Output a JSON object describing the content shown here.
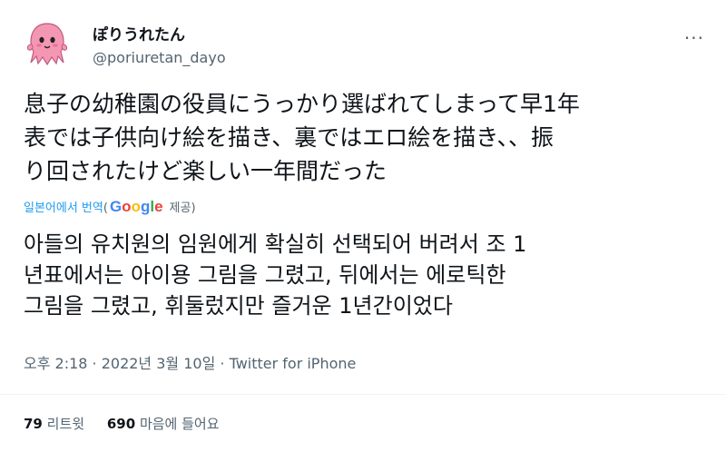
{
  "user": {
    "display_name": "ぽりうれたん",
    "handle": "@poriuretan_dayo"
  },
  "tweet": {
    "lines": [
      "息子の幼稚園の役員にうっかり選ばれてしまって早1年",
      "表では子供向け絵を描き、裏ではエロ絵を描き、、振",
      "り回されたけど楽しい一年間だった"
    ]
  },
  "translation": {
    "link_label": "일본어에서 번역",
    "paren_open": "(",
    "google_letters": [
      {
        "char": "G",
        "color": "#4285F4"
      },
      {
        "char": "o",
        "color": "#EA4335"
      },
      {
        "char": "o",
        "color": "#FBBC05"
      },
      {
        "char": "g",
        "color": "#4285F4"
      },
      {
        "char": "l",
        "color": "#34A853"
      },
      {
        "char": "e",
        "color": "#EA4335"
      }
    ],
    "provided_label": "제공)",
    "lines": [
      "아들의 유치원의 임원에게 확실히 선택되어 버려서 조 1",
      "년표에서는 아이용 그림을 그렸고, 뒤에서는 에로틱한",
      "그림을 그렸고, 휘둘렀지만 즐거운 1년간이었다"
    ]
  },
  "meta": {
    "time_date": "오후 2:18 · 2022년 3월 10일 · ",
    "source": "Twitter for iPhone"
  },
  "stats": {
    "retweets_count": "79",
    "retweets_label": "리트윗",
    "likes_count": "690",
    "likes_label": "마음에 들어요"
  },
  "colors": {
    "accent": "#1d9bf0",
    "avatar": "#f497b3"
  },
  "icons": {
    "more": "more-dots-icon",
    "avatar": "pink-octopus-avatar"
  }
}
